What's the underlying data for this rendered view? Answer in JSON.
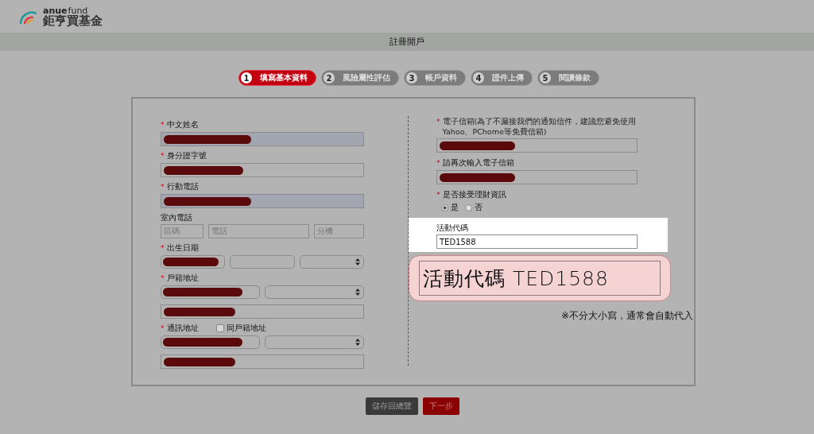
{
  "logo": {
    "wordmark_bold": "anue",
    "wordmark_light": "fund",
    "name": "鉅亨買基金"
  },
  "page_title": "註冊開戶",
  "steps": [
    {
      "number": "1",
      "label": "填寫基本資料",
      "selected": true
    },
    {
      "number": "2",
      "label": "風險屬性評估",
      "selected": false
    },
    {
      "number": "3",
      "label": "帳戶資料",
      "selected": false
    },
    {
      "number": "4",
      "label": "證件上傳",
      "selected": false
    },
    {
      "number": "5",
      "label": "閱讀條款",
      "selected": false
    }
  ],
  "left_fields": [
    {
      "kind": "text",
      "label": "中文姓名",
      "required_mark": "*",
      "autofilled": true,
      "redacted": true
    },
    {
      "kind": "text",
      "label": "身分證字號",
      "required_mark": "*",
      "autofilled": false,
      "redacted": true
    },
    {
      "kind": "text",
      "label": "行動電話",
      "required_mark": "*",
      "autofilled": true,
      "redacted": true
    },
    {
      "kind": "phone",
      "label": "室內電話",
      "placeholders": [
        "區碼",
        "電話",
        "分機"
      ]
    },
    {
      "kind": "date",
      "label": "出生日期",
      "required_mark": "*",
      "redacted": true
    },
    {
      "kind": "address",
      "label": "戶籍地址",
      "required_mark": "*",
      "redacted": true
    },
    {
      "kind": "address",
      "label": "通訊地址",
      "required_mark": "*",
      "redacted": true,
      "checkbox": {
        "label": "同戶籍地址",
        "checked": false
      }
    }
  ],
  "right_fields": [
    {
      "kind": "text",
      "label": "電子信箱",
      "note": "(為了不漏接我們的通知信件，建議您避免使用Yahoo、PChome等免費信箱)",
      "required_mark": "*",
      "redacted": true
    },
    {
      "kind": "text",
      "label": "請再次輸入電子信箱",
      "required_mark": "*",
      "redacted": true
    },
    {
      "kind": "radio",
      "label": "是否接受理財資訊",
      "required_mark": "*",
      "options": [
        {
          "label": "是",
          "selected": true
        },
        {
          "label": "否",
          "selected": false
        }
      ]
    },
    {
      "kind": "promo",
      "label": "活動代碼",
      "value": "TED1588",
      "highlighted": true
    }
  ],
  "callout": {
    "text": "活動代碼 TED1588",
    "note": "※不分大小寫，通常會自動代入"
  },
  "buttons": [
    {
      "label": "儲存回總覽",
      "kind": "secondary"
    },
    {
      "label": "下一步",
      "kind": "primary"
    }
  ]
}
